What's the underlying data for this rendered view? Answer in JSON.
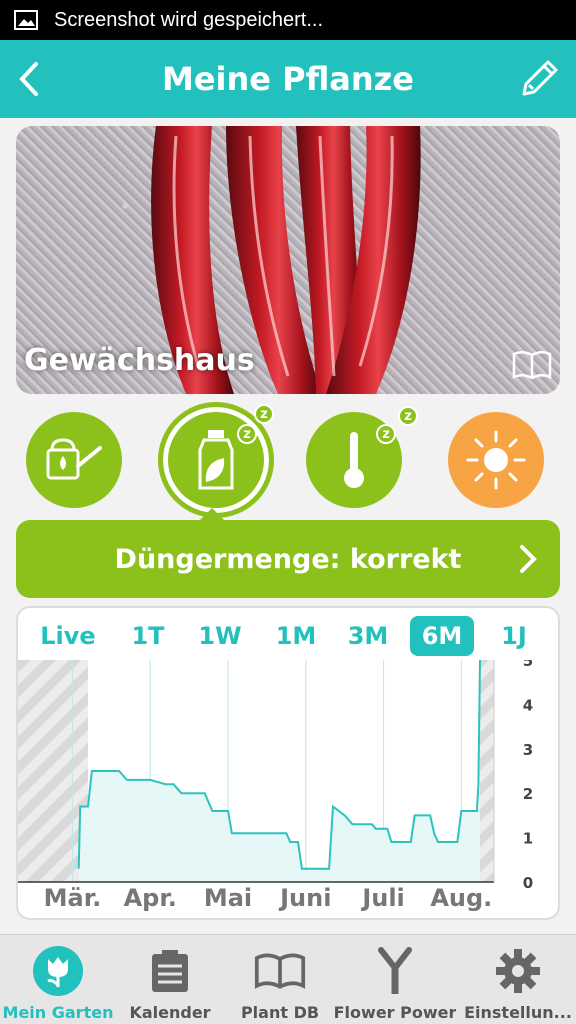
{
  "status_bar": {
    "text": "Screenshot wird gespeichert...",
    "icon": "image-icon"
  },
  "app_bar": {
    "title": "Meine Pflanze",
    "back_icon": "chevron-left-icon",
    "edit_icon": "pencil-icon"
  },
  "hero": {
    "location": "Gewächshaus",
    "icon": "book-icon"
  },
  "sensors": [
    {
      "name": "watering-can-icon",
      "color": "#8cc11b",
      "sleep_badge": false
    },
    {
      "name": "fertilizer-icon",
      "color": "#8cc11b",
      "sleep_badge": true,
      "selected": true
    },
    {
      "name": "thermometer-icon",
      "color": "#8cc11b",
      "sleep_badge": true
    },
    {
      "name": "sun-icon",
      "color": "#f7a445",
      "sleep_badge": false
    }
  ],
  "sleep_badge_text": "z",
  "status_banner": {
    "label": "Düngermenge: korrekt",
    "icon": "chevron-right-icon"
  },
  "ranges": [
    "Live",
    "1T",
    "1W",
    "1M",
    "3M",
    "6M",
    "1J"
  ],
  "active_range": "6M",
  "chart_data": {
    "type": "line",
    "x_tick_labels": [
      "Mär.",
      "Apr.",
      "Mai",
      "Juni",
      "Juli",
      "Aug."
    ],
    "y_ticks": [
      0,
      1,
      2,
      3,
      4,
      5
    ],
    "ylim": [
      0,
      5
    ],
    "series": [
      {
        "values": [
          [
            0.08,
            0.3
          ],
          [
            0.1,
            1.7
          ],
          [
            0.2,
            1.7
          ],
          [
            0.25,
            2.5
          ],
          [
            0.6,
            2.5
          ],
          [
            0.7,
            2.3
          ],
          [
            1.0,
            2.3
          ],
          [
            1.2,
            2.2
          ],
          [
            1.3,
            2.2
          ],
          [
            1.4,
            2.0
          ],
          [
            1.7,
            2.0
          ],
          [
            1.8,
            1.6
          ],
          [
            2.0,
            1.6
          ],
          [
            2.05,
            1.1
          ],
          [
            2.75,
            1.1
          ],
          [
            2.8,
            0.9
          ],
          [
            2.9,
            0.9
          ],
          [
            2.95,
            0.3
          ],
          [
            3.3,
            0.3
          ],
          [
            3.35,
            1.7
          ],
          [
            3.5,
            1.5
          ],
          [
            3.6,
            1.3
          ],
          [
            3.85,
            1.3
          ],
          [
            3.9,
            1.2
          ],
          [
            4.05,
            1.2
          ],
          [
            4.1,
            0.9
          ],
          [
            4.35,
            0.9
          ],
          [
            4.4,
            1.5
          ],
          [
            4.6,
            1.5
          ],
          [
            4.65,
            1.1
          ],
          [
            4.7,
            0.9
          ],
          [
            4.95,
            0.9
          ],
          [
            5.0,
            1.6
          ],
          [
            5.2,
            1.6
          ],
          [
            5.22,
            2.2
          ],
          [
            5.24,
            5.0
          ]
        ]
      }
    ],
    "hatched_regions": [
      [
        -0.7,
        0.2
      ],
      [
        5.24,
        5.42
      ]
    ],
    "colors": {
      "line": "#2cc3bf",
      "fill": "#e6f7f7",
      "grid": "#bfe7e6",
      "axis": "#333333"
    }
  },
  "bottom_nav": [
    {
      "label": "Mein Garten",
      "icon": "tulip-icon",
      "active": true
    },
    {
      "label": "Kalender",
      "icon": "calendar-icon",
      "active": false
    },
    {
      "label": "Plant DB",
      "icon": "book-open-icon",
      "active": false
    },
    {
      "label": "Flower Power",
      "icon": "sensor-fork-icon",
      "active": false
    },
    {
      "label": "Einstellun...",
      "icon": "gear-icon",
      "active": false
    }
  ],
  "colors": {
    "teal": "#23c1bd",
    "green": "#8cc11b",
    "orange": "#f7a445"
  }
}
